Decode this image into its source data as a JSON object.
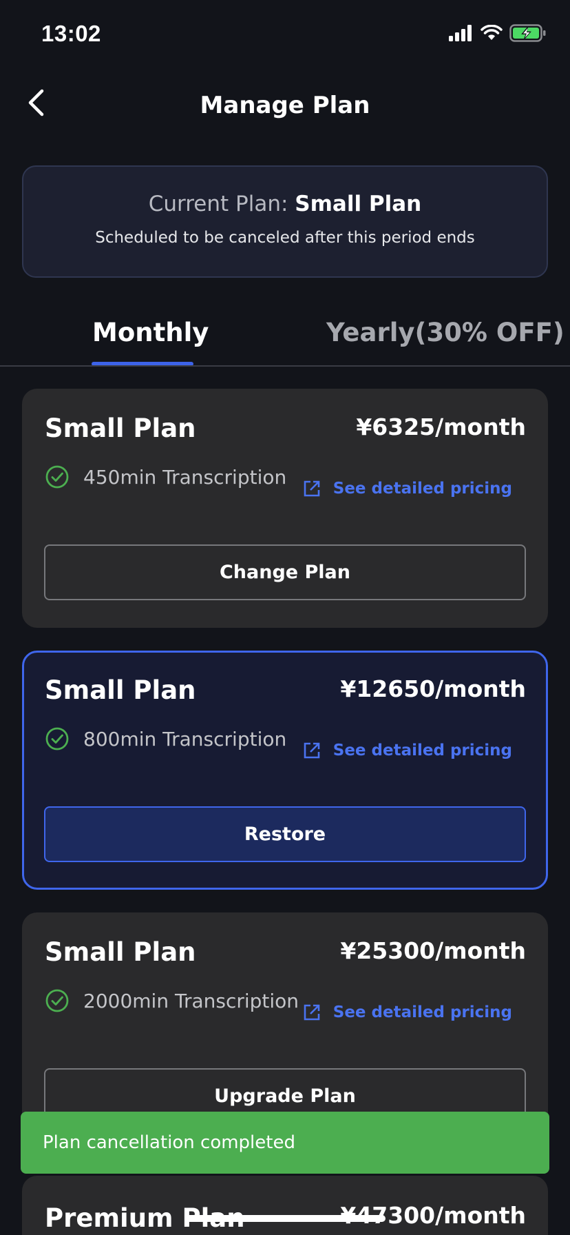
{
  "status_bar": {
    "time": "13:02"
  },
  "nav": {
    "title": "Manage Plan"
  },
  "current_plan": {
    "label": "Current Plan: ",
    "name": "Small Plan",
    "note": "Scheduled to be canceled after this period ends"
  },
  "tabs": [
    {
      "label": "Monthly",
      "selected": true
    },
    {
      "label": "Yearly(30% OFF)",
      "selected": false
    }
  ],
  "plans": [
    {
      "name": "Small Plan",
      "price": "¥6325/month",
      "feature": "450min Transcription",
      "link": "See detailed pricing",
      "button": "Change Plan",
      "selected": false
    },
    {
      "name": "Small Plan",
      "price": "¥12650/month",
      "feature": "800min Transcription",
      "link": "See detailed pricing",
      "button": "Restore",
      "selected": true
    },
    {
      "name": "Small Plan",
      "price": "¥25300/month",
      "feature": "2000min Transcription",
      "link": "See detailed pricing",
      "button": "Upgrade Plan",
      "selected": false
    },
    {
      "name": "Premium Plan",
      "price": "¥47300/month"
    }
  ],
  "toast": {
    "message": "Plan cancellation completed"
  },
  "colors": {
    "background": "#12141a",
    "accent": "#3f66ec",
    "link": "#4a73f0",
    "check": "#4caf50",
    "toast": "#4cae50"
  }
}
